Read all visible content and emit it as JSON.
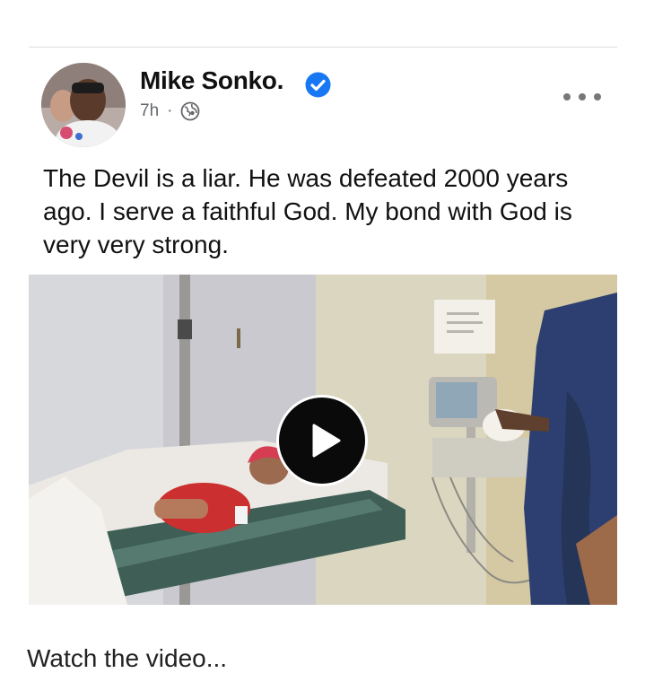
{
  "post": {
    "author": "Mike Sonko.",
    "timestamp": "7h",
    "separator": "·",
    "privacy_icon": "globe-icon",
    "verified_icon": "verified-badge-icon",
    "verified_color": "#1877f2",
    "more_icon": "more-options-icon",
    "text": "The Devil is a liar. He was defeated 2000 years ago. I serve a faithful God. My bond with God is very very strong.",
    "media": {
      "type": "video",
      "play_icon": "play-icon"
    },
    "next_text": "Watch the video..."
  }
}
